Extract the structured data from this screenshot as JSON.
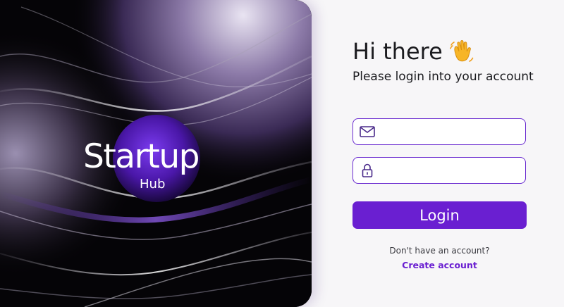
{
  "brand": {
    "title": "Startup",
    "subtitle": "Hub"
  },
  "login": {
    "greeting": "Hi there",
    "greeting_icon": "waving-hand-icon",
    "subtitle": "Please login into your account",
    "email_icon": "envelope-icon",
    "email_value": "",
    "password_icon": "lock-icon",
    "password_value": "",
    "button_label": "Login",
    "signup_prompt": "Don't have an account?",
    "signup_link": "Create account"
  },
  "colors": {
    "accent": "#6a1fd1",
    "field_border": "#6a2bd0",
    "hero_background": "#050407",
    "text": "#1b1b1f"
  }
}
